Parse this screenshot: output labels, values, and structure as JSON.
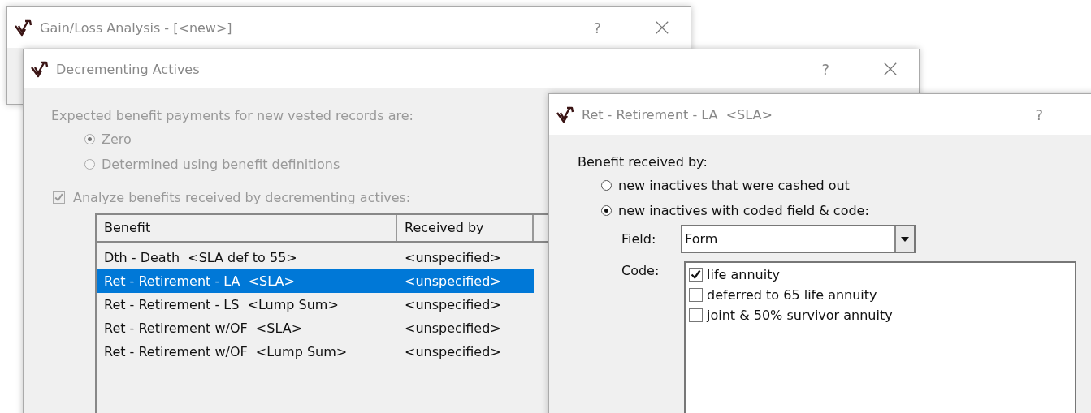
{
  "main_window": {
    "title": "Gain/Loss Analysis - [<new>]",
    "help": "?"
  },
  "decrementing_dialog": {
    "title": "Decrementing Actives",
    "help": "?",
    "vested_payments": {
      "prompt": "Expected benefit payments for new vested records are:",
      "disabled": true,
      "options": [
        {
          "label": "Zero",
          "selected": true
        },
        {
          "label": "Determined using benefit definitions",
          "selected": false
        }
      ]
    },
    "analyze": {
      "label": "Analyze benefits received by decrementing actives:",
      "checked": true,
      "disabled": true
    },
    "table": {
      "columns": [
        "Benefit",
        "Received by"
      ],
      "rows": [
        {
          "benefit": "Dth - Death  <SLA def to 55>",
          "received_by": "<unspecified>",
          "selected": false
        },
        {
          "benefit": "Ret - Retirement - LA  <SLA>",
          "received_by": "<unspecified>",
          "selected": true
        },
        {
          "benefit": "Ret - Retirement - LS  <Lump Sum>",
          "received_by": "<unspecified>",
          "selected": false
        },
        {
          "benefit": "Ret - Retirement w/OF  <SLA>",
          "received_by": "<unspecified>",
          "selected": false
        },
        {
          "benefit": "Ret - Retirement w/OF  <Lump Sum>",
          "received_by": "<unspecified>",
          "selected": false
        }
      ]
    }
  },
  "benefit_dialog": {
    "title": "Ret - Retirement - LA  <SLA>",
    "help": "?",
    "prompt": "Benefit received by:",
    "options": [
      {
        "label": "new inactives that were cashed out",
        "selected": false
      },
      {
        "label": "new inactives with coded field & code:",
        "selected": true
      }
    ],
    "field": {
      "label": "Field:",
      "value": "Form"
    },
    "code": {
      "label": "Code:",
      "items": [
        {
          "label": "life annuity",
          "checked": true
        },
        {
          "label": "deferred to 65 life annuity",
          "checked": false
        },
        {
          "label": "joint & 50% survivor annuity",
          "checked": false
        }
      ]
    }
  }
}
